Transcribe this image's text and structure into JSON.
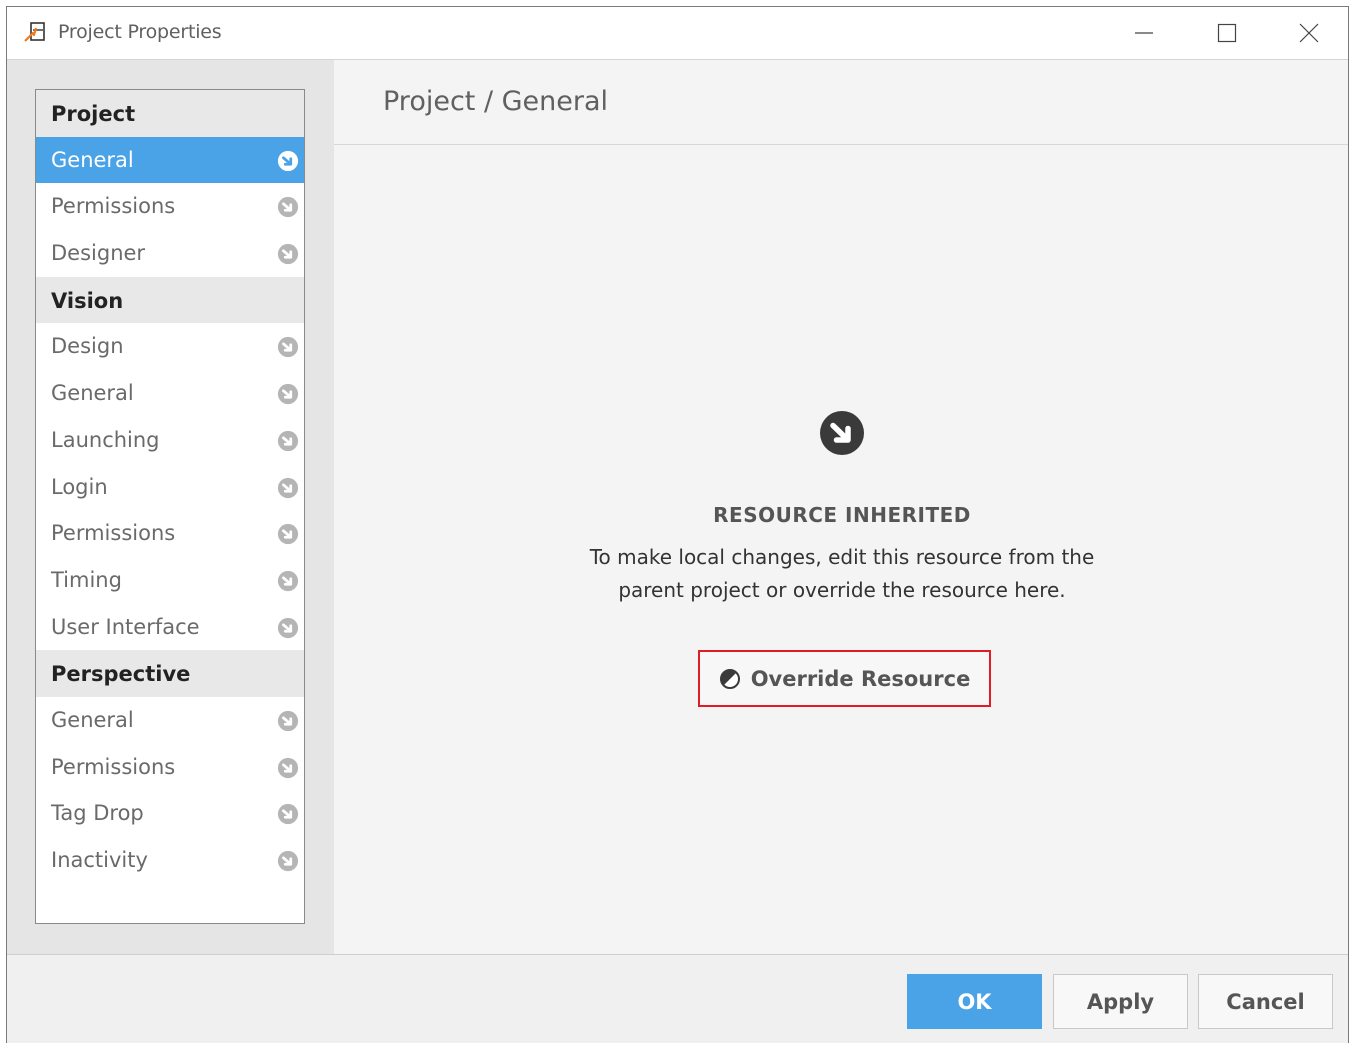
{
  "window": {
    "title": "Project Properties"
  },
  "sidebar": {
    "groups": [
      {
        "header": "Project",
        "items": [
          {
            "label": "General",
            "selected": true
          },
          {
            "label": "Permissions"
          },
          {
            "label": "Designer"
          }
        ]
      },
      {
        "header": "Vision",
        "items": [
          {
            "label": "Design"
          },
          {
            "label": "General"
          },
          {
            "label": "Launching"
          },
          {
            "label": "Login"
          },
          {
            "label": "Permissions"
          },
          {
            "label": "Timing"
          },
          {
            "label": "User Interface"
          }
        ]
      },
      {
        "header": "Perspective",
        "items": [
          {
            "label": "General"
          },
          {
            "label": "Permissions"
          },
          {
            "label": "Tag Drop"
          },
          {
            "label": "Inactivity"
          }
        ]
      }
    ],
    "item_icon": "inherited-resource-icon"
  },
  "main": {
    "breadcrumb": "Project / General",
    "notice_icon": "inherited-resource-icon",
    "notice_title": "RESOURCE INHERITED",
    "notice_line1": "To make local changes, edit this resource from the",
    "notice_line2": "parent project or override the resource here.",
    "override_icon": "override-icon",
    "override_label": "Override Resource",
    "highlight_color": "#e01c24"
  },
  "footer": {
    "ok_label": "OK",
    "apply_label": "Apply",
    "cancel_label": "Cancel"
  },
  "colors": {
    "accent": "#4aa3e6",
    "icon_gray": "#b5b5b5",
    "icon_dark": "#3a3a3a"
  }
}
